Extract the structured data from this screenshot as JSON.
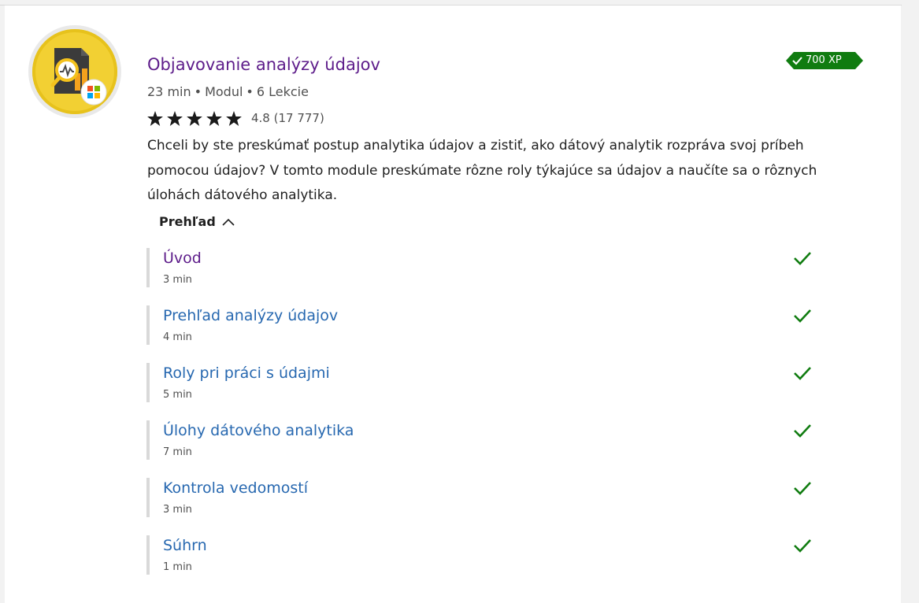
{
  "module": {
    "title": "Objavovanie analýzy údajov",
    "xp": "700 XP",
    "duration": "23 min",
    "type": "Modul",
    "lessons": "6 Lekcie",
    "rating_value": "4.8",
    "rating_count": "(17 777)",
    "rating_stars": 5,
    "description": "Chceli by ste preskúmať postup analytika údajov a zistiť, ako dátový analytik rozpráva svoj príbeh pomocou údajov? V tomto module preskúmate rôzne roly týkajúce sa údajov a naučíte sa o rôznych úlohách dátového analytika."
  },
  "overview": {
    "label": "Prehľad"
  },
  "units": [
    {
      "title": "Úvod",
      "time": "3 min",
      "completed": true
    },
    {
      "title": "Prehľad analýzy údajov",
      "time": "4 min",
      "completed": true
    },
    {
      "title": "Roly pri práci s údajmi",
      "time": "5 min",
      "completed": true
    },
    {
      "title": "Úlohy dátového analytika",
      "time": "7 min",
      "completed": true
    },
    {
      "title": "Kontrola vedomostí",
      "time": "3 min",
      "completed": true
    },
    {
      "title": "Súhrn",
      "time": "1 min",
      "completed": true
    }
  ],
  "colors": {
    "title": "#5d1c8a",
    "link": "#2768b0",
    "xp_badge": "#107c10",
    "check": "#107c10",
    "badge_gold": "#f2d033"
  },
  "icons": {
    "badge": "module-badge-icon",
    "xp_check": "check-icon",
    "star": "star-icon",
    "chevron": "chevron-up-icon",
    "unit_check": "check-icon"
  }
}
